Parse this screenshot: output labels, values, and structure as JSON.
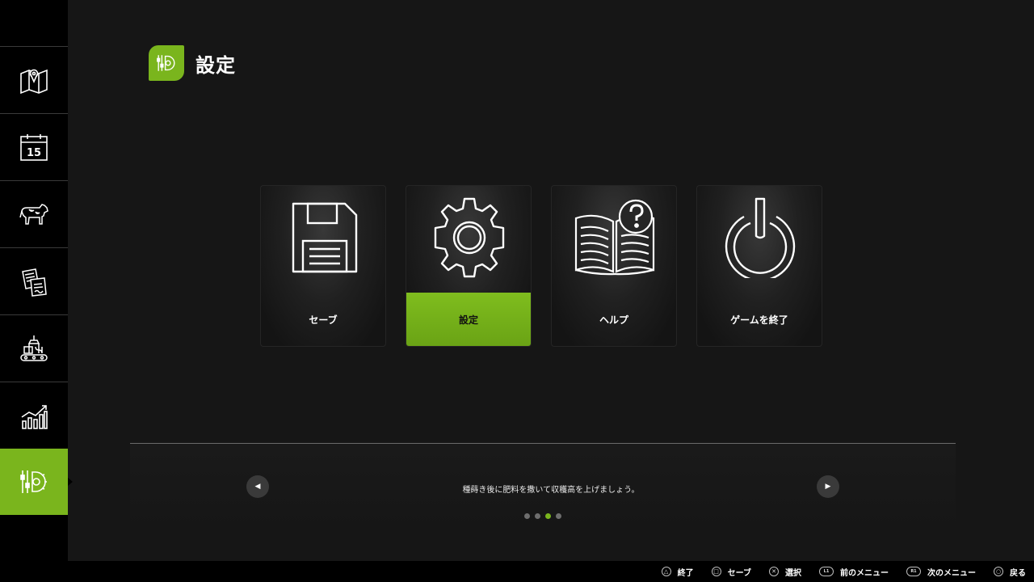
{
  "colors": {
    "accent": "#7ab51d",
    "background": "#161616",
    "sidebar": "#000000"
  },
  "sidebar": {
    "items": [
      {
        "icon": "map-icon"
      },
      {
        "icon": "calendar-icon",
        "day": "15"
      },
      {
        "icon": "livestock-icon"
      },
      {
        "icon": "contracts-icon"
      },
      {
        "icon": "production-icon"
      },
      {
        "icon": "statistics-icon"
      },
      {
        "icon": "settings-menu-icon",
        "active": true
      }
    ]
  },
  "header": {
    "title": "設定",
    "icon": "settings-menu-icon"
  },
  "menu": {
    "cards": [
      {
        "label": "セーブ",
        "icon": "floppy-disk-icon"
      },
      {
        "label": "設定",
        "icon": "gear-icon",
        "selected": true
      },
      {
        "label": "ヘルプ",
        "icon": "help-book-icon"
      },
      {
        "label": "ゲームを終了",
        "icon": "power-icon"
      }
    ]
  },
  "tip": {
    "text": "種蒔き後に肥料を撒いて収穫高を上げましょう。",
    "prev_icon": "prev-arrow-icon",
    "next_icon": "next-arrow-icon",
    "page_count": 4,
    "active_page": 3
  },
  "footer": {
    "hints": [
      {
        "button": "triangle",
        "glyph": "△",
        "label": "終了"
      },
      {
        "button": "square",
        "glyph": "□",
        "label": "セーブ"
      },
      {
        "button": "cross",
        "glyph": "✕",
        "label": "選択"
      },
      {
        "button": "L1",
        "glyph": "L1",
        "label": "前のメニュー"
      },
      {
        "button": "R1",
        "glyph": "R1",
        "label": "次のメニュー"
      },
      {
        "button": "circle",
        "glyph": "○",
        "label": "戻る"
      }
    ]
  }
}
